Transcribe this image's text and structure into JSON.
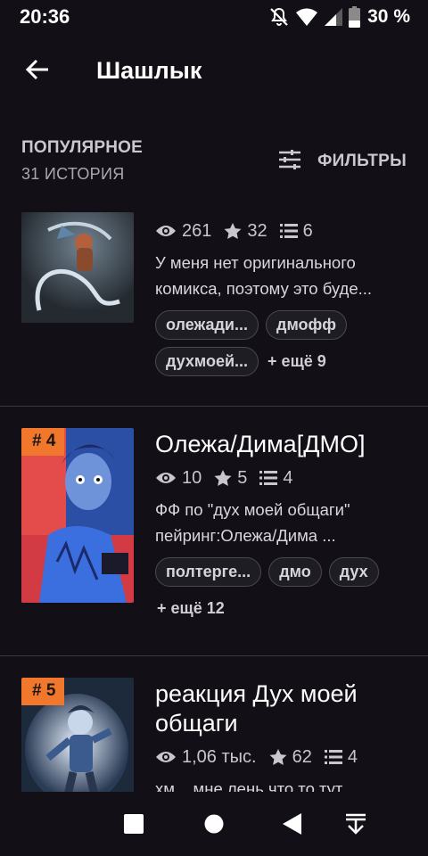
{
  "status_bar": {
    "time": "20:36",
    "battery": "30 %",
    "icons": [
      "mute-icon",
      "wifi-icon",
      "signal-icon",
      "battery-icon"
    ]
  },
  "app_bar": {
    "title": "Шашлык",
    "back_icon": "arrow-left-icon"
  },
  "section": {
    "title": "ПОПУЛЯРНОЕ",
    "count": "31 ИСТОРИЯ",
    "filters_label": "ФИЛЬТРЫ",
    "filters_icon": "sliders-icon"
  },
  "stories": [
    {
      "rank": "",
      "title": "",
      "views": "261",
      "stars": "32",
      "parts": "6",
      "description": [
        "У меня нет оригинального",
        "комикса, поэтому это буде..."
      ],
      "tags": [
        "олежади...",
        "дмофф",
        "духмоей..."
      ],
      "more_tags": "+ ещё 9"
    },
    {
      "rank": "# 4",
      "title": "Олежа/Дима[ДМО]",
      "views": "10",
      "stars": "5",
      "parts": "4",
      "description": [
        "ФФ по \"дух моей общаги\"",
        "пейринг:Олежа/Дима ..."
      ],
      "tags": [
        "полтерге...",
        "дмо",
        "дух"
      ],
      "more_tags": "+ ещё 12"
    },
    {
      "rank": "# 5",
      "title": "реакция Дух моей общаги",
      "views": "1,06 тыс.",
      "stars": "62",
      "parts": "4",
      "description": [
        "хм... мне лень что то тут"
      ],
      "tags": [],
      "more_tags": ""
    }
  ],
  "nav_bar": {
    "icons": [
      "recents-square-icon",
      "home-circle-icon",
      "back-triangle-icon",
      "collapse-down-icon"
    ]
  },
  "colors": {
    "background": "#121016",
    "rank_badge": "#f0772b",
    "divider": "#3a3940",
    "tag_border": "#4a4950"
  }
}
